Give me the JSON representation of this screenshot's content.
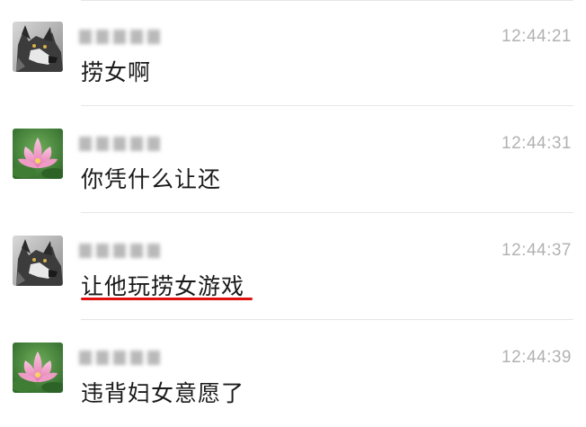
{
  "messages": [
    {
      "avatar": "wolf-avatar",
      "sender": "",
      "time": "12:44:21",
      "text": "捞女啊",
      "highlighted": false
    },
    {
      "avatar": "lotus-avatar",
      "sender": "",
      "time": "12:44:31",
      "text": "你凭什么让还",
      "highlighted": false
    },
    {
      "avatar": "wolf-avatar",
      "sender": "",
      "time": "12:44:37",
      "text": "让他玩捞女游戏",
      "highlighted": true
    },
    {
      "avatar": "lotus-avatar",
      "sender": "",
      "time": "12:44:39",
      "text": "违背妇女意愿了",
      "highlighted": false
    }
  ],
  "colors": {
    "text": "#1a1a1a",
    "timestamp": "#b2b2b2",
    "divider": "#e6e6e6",
    "underline": "#e01010"
  }
}
